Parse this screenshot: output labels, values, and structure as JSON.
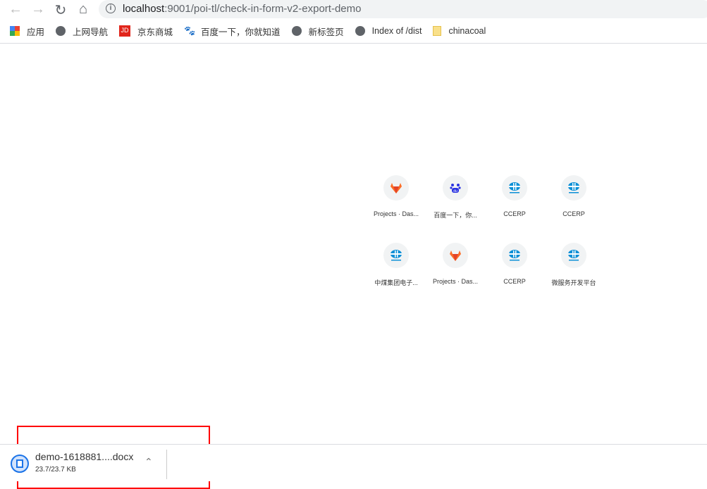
{
  "browser": {
    "url_host": "localhost",
    "url_path": ":9001/poi-tl/check-in-form-v2-export-demo"
  },
  "bookmarks": [
    {
      "label": "应用",
      "icon": "apps-grid-icon"
    },
    {
      "label": "上网导航",
      "icon": "globe-icon"
    },
    {
      "label": "京东商城",
      "icon": "jd-icon"
    },
    {
      "label": "百度一下，你就知道",
      "icon": "baidu-icon"
    },
    {
      "label": "新标签页",
      "icon": "globe-icon"
    },
    {
      "label": "Index of /dist",
      "icon": "globe-icon"
    },
    {
      "label": "chinacoal",
      "icon": "folder-icon"
    }
  ],
  "shortcuts": [
    {
      "label": "Projects · Das...",
      "icon": "gitlab-icon"
    },
    {
      "label": "百度一下，你...",
      "icon": "baidu-icon"
    },
    {
      "label": "CCERP",
      "icon": "chinacoal-icon"
    },
    {
      "label": "CCERP",
      "icon": "chinacoal-icon"
    },
    {
      "label": "中煤集团电子...",
      "icon": "chinacoal-icon"
    },
    {
      "label": "Projects · Das...",
      "icon": "gitlab-icon"
    },
    {
      "label": "CCERP",
      "icon": "chinacoal-icon"
    },
    {
      "label": "微服务开发平台",
      "icon": "chinacoal-icon"
    }
  ],
  "download": {
    "filename": "demo-1618881....docx",
    "progress": "23.7/23.7 KB"
  },
  "colors": {
    "annotation": "#ff0000",
    "accent": "#1a73e8"
  }
}
